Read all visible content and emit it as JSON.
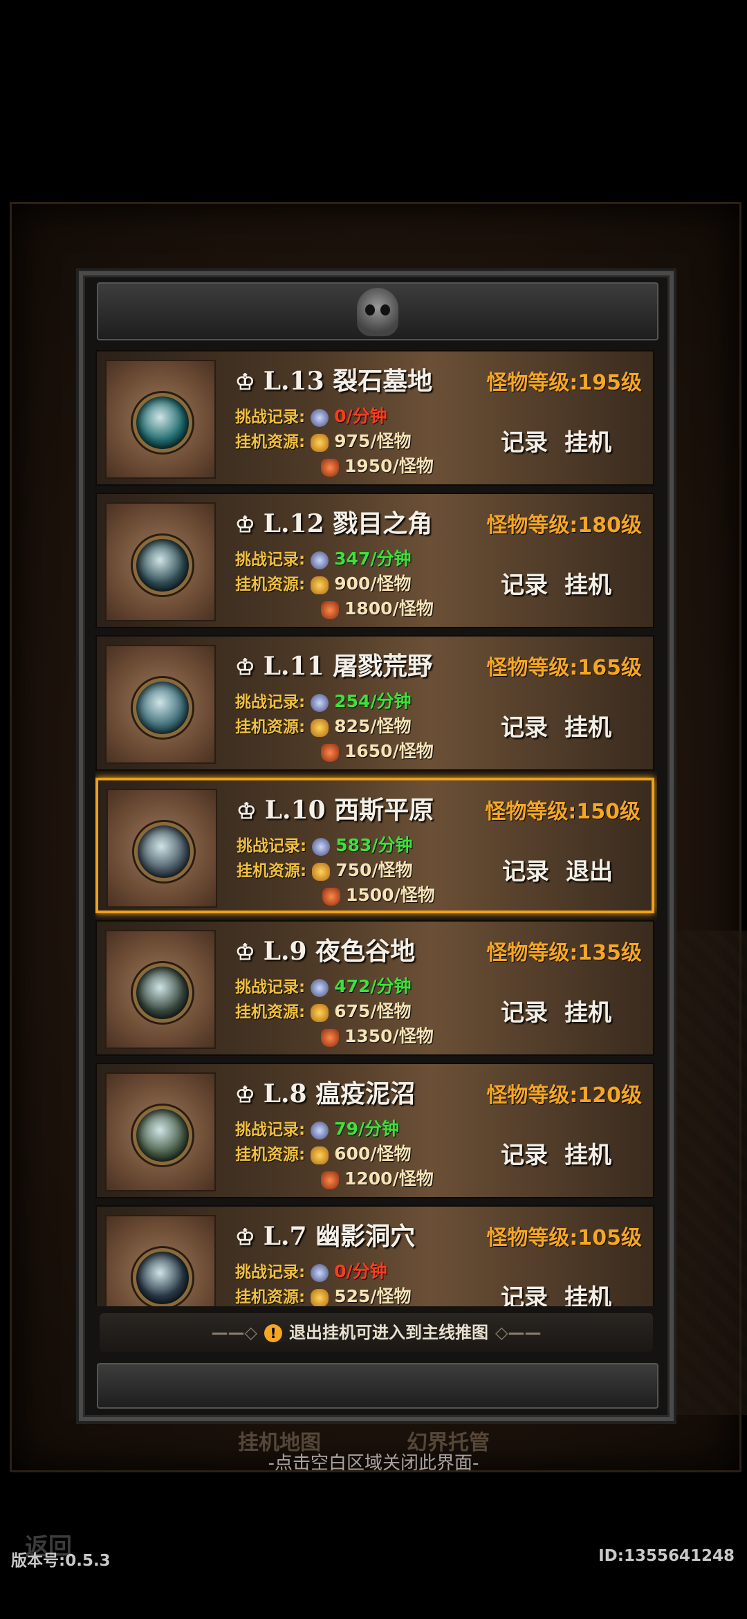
{
  "status_bar": {
    "left": "",
    "right": ""
  },
  "maps": [
    {
      "title": "L.13 裂石墓地",
      "level": "怪物等级:195级",
      "challenge_label": "挑战记录:",
      "challenge_value": "0/分钟",
      "challenge_color": "red",
      "resource_label": "挂机资源:",
      "coin_value": "975/怪物",
      "bag_value": "1950/怪物",
      "btn1": "记录",
      "btn2": "挂机",
      "active": false,
      "orb_color": "#1e6b6e"
    },
    {
      "title": "L.12 戮目之角",
      "level": "怪物等级:180级",
      "challenge_label": "挑战记录:",
      "challenge_value": "347/分钟",
      "challenge_color": "green",
      "resource_label": "挂机资源:",
      "coin_value": "900/怪物",
      "bag_value": "1800/怪物",
      "btn1": "记录",
      "btn2": "挂机",
      "active": false,
      "orb_color": "#2f4d55"
    },
    {
      "title": "L.11 屠戮荒野",
      "level": "怪物等级:165级",
      "challenge_label": "挑战记录:",
      "challenge_value": "254/分钟",
      "challenge_color": "green",
      "resource_label": "挂机资源:",
      "coin_value": "825/怪物",
      "bag_value": "1650/怪物",
      "btn1": "记录",
      "btn2": "挂机",
      "active": false,
      "orb_color": "#3f6f7a"
    },
    {
      "title": "L.10 西斯平原",
      "level": "怪物等级:150级",
      "challenge_label": "挑战记录:",
      "challenge_value": "583/分钟",
      "challenge_color": "green",
      "resource_label": "挂机资源:",
      "coin_value": "750/怪物",
      "bag_value": "1500/怪物",
      "btn1": "记录",
      "btn2": "退出",
      "active": true,
      "orb_color": "#4a5a66"
    },
    {
      "title": "L.9 夜色谷地",
      "level": "怪物等级:135级",
      "challenge_label": "挑战记录:",
      "challenge_value": "472/分钟",
      "challenge_color": "green",
      "resource_label": "挂机资源:",
      "coin_value": "675/怪物",
      "bag_value": "1350/怪物",
      "btn1": "记录",
      "btn2": "挂机",
      "active": false,
      "orb_color": "#3a4a40"
    },
    {
      "title": "L.8 瘟疫泥沼",
      "level": "怪物等级:120级",
      "challenge_label": "挑战记录:",
      "challenge_value": "79/分钟",
      "challenge_color": "green",
      "resource_label": "挂机资源:",
      "coin_value": "600/怪物",
      "bag_value": "1200/怪物",
      "btn1": "记录",
      "btn2": "挂机",
      "active": false,
      "orb_color": "#4a5e48"
    },
    {
      "title": "L.7 幽影洞穴",
      "level": "怪物等级:105级",
      "challenge_label": "挑战记录:",
      "challenge_value": "0/分钟",
      "challenge_color": "red",
      "resource_label": "挂机资源:",
      "coin_value": "525/怪物",
      "bag_value": "",
      "btn1": "记录",
      "btn2": "挂机",
      "active": false,
      "orb_color": "#2a3a48"
    }
  ],
  "footer_note": "退出挂机可进入到主线推图",
  "tabs": {
    "left": "挂机地图",
    "right": "幻界托管"
  },
  "close_hint": "-点击空白区域关闭此界面-",
  "back": "返回",
  "version": "版本号:0.5.3",
  "uid": "ID:1355641248",
  "colors": {
    "accent": "#f5a623",
    "green": "#39e33a",
    "red": "#ff3b1e"
  }
}
